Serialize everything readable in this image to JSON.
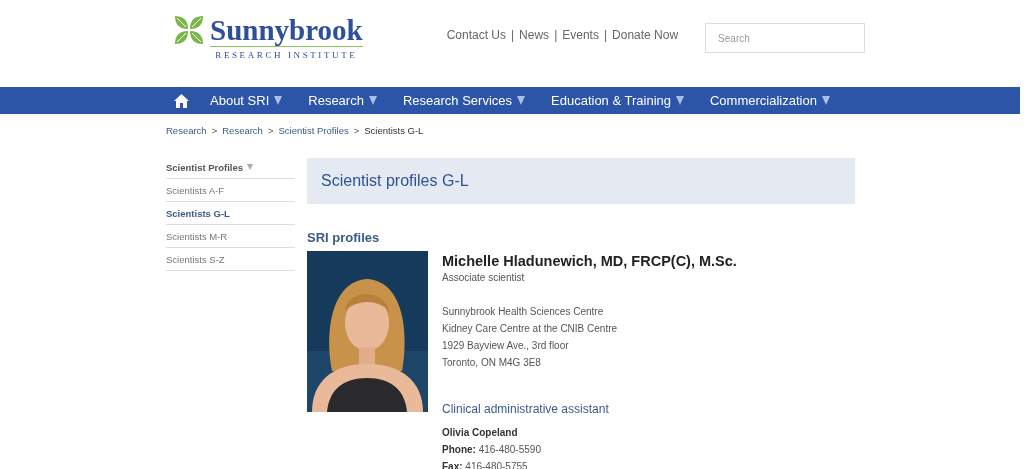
{
  "header": {
    "logo": {
      "name": "Sunnybrook",
      "tagline": "RESEARCH INSTITUTE"
    },
    "top_links": {
      "separator": "|",
      "items": [
        "Contact Us",
        "News",
        "Events",
        "Donate Now"
      ]
    },
    "search": {
      "placeholder": "Search"
    }
  },
  "nav": {
    "items": [
      {
        "kind": "home"
      },
      {
        "kind": "menu",
        "label": "About SRI",
        "dropdown": true
      },
      {
        "kind": "menu",
        "label": "Research",
        "dropdown": true
      },
      {
        "kind": "menu",
        "label": "Research Services",
        "dropdown": true
      },
      {
        "kind": "menu",
        "label": "Education & Training",
        "dropdown": true
      },
      {
        "kind": "menu",
        "label": "Commercialization",
        "dropdown": true
      }
    ]
  },
  "breadcrumb": {
    "separator": ">",
    "items": [
      {
        "label": "Research",
        "current": false
      },
      {
        "label": "Research",
        "current": false
      },
      {
        "label": "Scientist Profiles",
        "current": false
      },
      {
        "label": "Scientists G-L",
        "current": true
      }
    ]
  },
  "sidebar": {
    "title": "Scientist Profiles",
    "items": [
      {
        "label": "Scientists A-F",
        "selected": false
      },
      {
        "label": "Scientists G-L",
        "selected": true
      },
      {
        "label": "Scientists M-R",
        "selected": false
      },
      {
        "label": "Scientists S-Z",
        "selected": false
      }
    ]
  },
  "page_title": "Scientist profiles G-L",
  "section_title": "SRI profiles",
  "profile": {
    "name": "Michelle Hladunewich, MD, FRCP(C), M.Sc.",
    "role": "Associate scientist",
    "address": [
      "Sunnybrook Health Sciences Centre",
      "Kidney Care Centre at the CNIB Centre",
      "1929 Bayview Ave., 3rd floor",
      "Toronto, ON M4G 3E8"
    ],
    "assistant": {
      "heading": "Clinical administrative assistant",
      "name": "Olivia Copeland",
      "lines": [
        "**Phone:** 416-480-5590",
        "**Fax:** 416-480-5755"
      ]
    }
  }
}
